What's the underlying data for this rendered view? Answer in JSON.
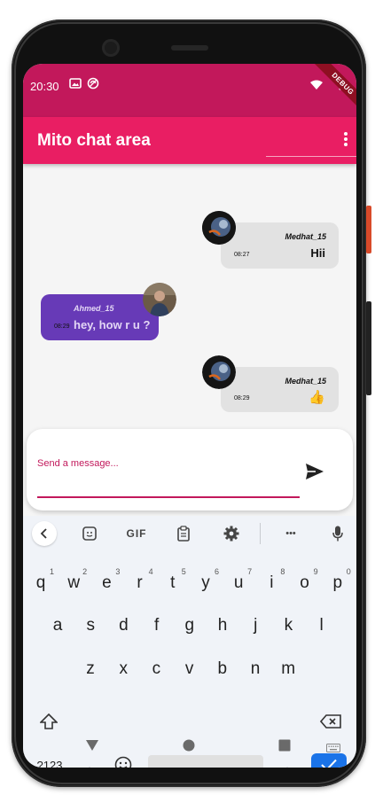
{
  "status_bar": {
    "time": "20:30",
    "debug_label": "DEBUG"
  },
  "app_bar": {
    "title": "Mito chat area"
  },
  "messages": [
    {
      "sender": "Medhat_15",
      "text": "Hii",
      "time": "08:27",
      "side": "right"
    },
    {
      "sender": "Ahmed_15",
      "text": "hey, how r u ?",
      "time": "08:29",
      "side": "left"
    },
    {
      "sender": "Medhat_15",
      "text": "👍",
      "time": "08:29",
      "side": "right"
    }
  ],
  "composer": {
    "placeholder": "Send a message...",
    "value": ""
  },
  "keyboard": {
    "toolbar": {
      "gif_label": "GIF",
      "more_label": "•••"
    },
    "row1": [
      {
        "key": "q",
        "hint": "1"
      },
      {
        "key": "w",
        "hint": "2"
      },
      {
        "key": "e",
        "hint": "3"
      },
      {
        "key": "r",
        "hint": "4"
      },
      {
        "key": "t",
        "hint": "5"
      },
      {
        "key": "y",
        "hint": "6"
      },
      {
        "key": "u",
        "hint": "7"
      },
      {
        "key": "i",
        "hint": "8"
      },
      {
        "key": "o",
        "hint": "9"
      },
      {
        "key": "p",
        "hint": "0"
      }
    ],
    "row2": [
      "a",
      "s",
      "d",
      "f",
      "g",
      "h",
      "j",
      "k",
      "l"
    ],
    "row3": [
      "z",
      "x",
      "c",
      "v",
      "b",
      "n",
      "m"
    ],
    "symbols_label": "?123",
    "comma": ",",
    "period": "."
  },
  "colors": {
    "status_bar": "#c2185b",
    "app_bar": "#e91e63",
    "my_bubble": "#e2e2e2",
    "other_bubble": "#673ab7",
    "accent": "#c2185b",
    "keyboard_accent": "#1a73e8"
  }
}
